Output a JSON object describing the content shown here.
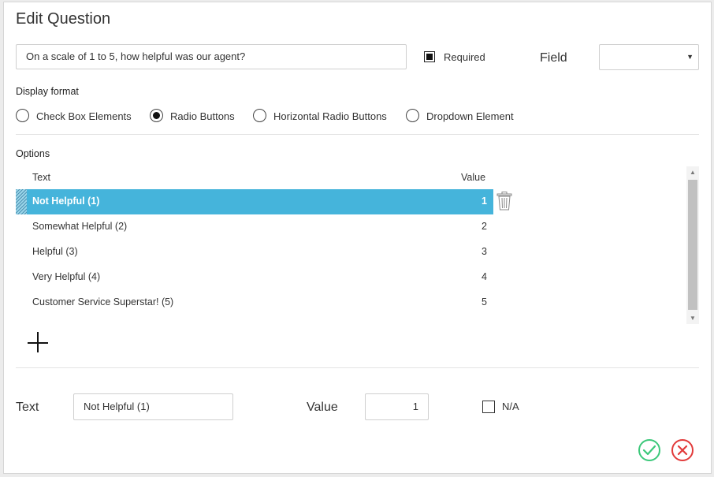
{
  "dialog": {
    "title": "Edit Question",
    "question_value": "On a scale of 1 to 5, how helpful was our agent?",
    "required_label": "Required",
    "required_checked": true,
    "field_label": "Field",
    "field_value": "",
    "display_format_label": "Display format",
    "display_formats": [
      {
        "label": "Check Box Elements",
        "checked": false
      },
      {
        "label": "Radio Buttons",
        "checked": true
      },
      {
        "label": "Horizontal Radio Buttons",
        "checked": false
      },
      {
        "label": "Dropdown Element",
        "checked": false
      }
    ],
    "options_label": "Options",
    "columns": {
      "text": "Text",
      "value": "Value"
    },
    "options": [
      {
        "text": "Not Helpful (1)",
        "value": "1",
        "selected": true
      },
      {
        "text": "Somewhat Helpful (2)",
        "value": "2",
        "selected": false
      },
      {
        "text": "Helpful (3)",
        "value": "3",
        "selected": false
      },
      {
        "text": "Very Helpful (4)",
        "value": "4",
        "selected": false
      },
      {
        "text": "Customer Service Superstar! (5)",
        "value": "5",
        "selected": false
      }
    ],
    "editor": {
      "text_label": "Text",
      "text_value": "Not Helpful (1)",
      "value_label": "Value",
      "value_value": "1",
      "na_label": "N/A",
      "na_checked": false
    },
    "colors": {
      "selection": "#45b4db",
      "ok": "#3cc87a",
      "cancel": "#e23a3a"
    }
  }
}
